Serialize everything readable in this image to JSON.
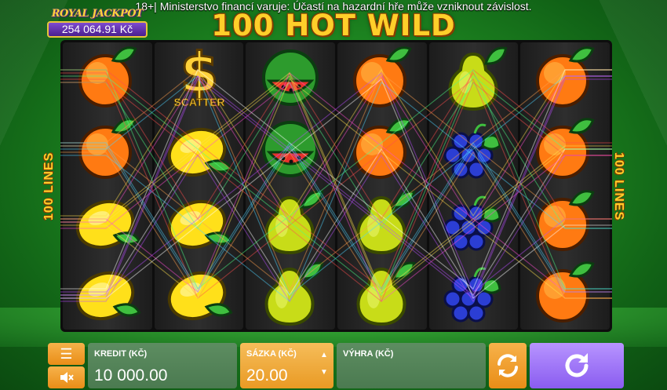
{
  "warning_text": "18+| Ministerstvo financí varuje: Účastí na hazardní hře může vzniknout závislost.",
  "jackpot": {
    "title": "ROYAL JACKPOT",
    "value": "254 064.91 Kč"
  },
  "game_title": "100 HOT WILD",
  "lines_label": "100 LINES",
  "scatter_label": "SCATTER",
  "reels": [
    [
      "orange",
      "orange",
      "lemon",
      "lemon"
    ],
    [
      "scatter",
      "lemon",
      "lemon",
      "lemon"
    ],
    [
      "watermelon",
      "watermelon",
      "pear",
      "pear"
    ],
    [
      "orange",
      "orange",
      "pear",
      "pear"
    ],
    [
      "pear",
      "grapes",
      "grapes",
      "grapes"
    ],
    [
      "orange",
      "orange",
      "orange",
      "orange"
    ]
  ],
  "bottom_bar": {
    "credit_label": "KREDIT (KČ)",
    "credit_value": "10 000.00",
    "bet_label": "SÁZKA (KČ)",
    "bet_value": "20.00",
    "win_label": "VÝHRA (KČ)",
    "win_value": ""
  },
  "colors": {
    "accent_orange": "#e98d17",
    "spin_purple": "#8a5cf0",
    "panel_green": "#4b7a50",
    "title_gold": "#ffcf2a"
  },
  "icons": {
    "menu": "hamburger-icon",
    "sound": "speaker-muted-icon",
    "autoplay": "autoplay-arrows-icon",
    "spin": "spin-arrow-icon"
  }
}
